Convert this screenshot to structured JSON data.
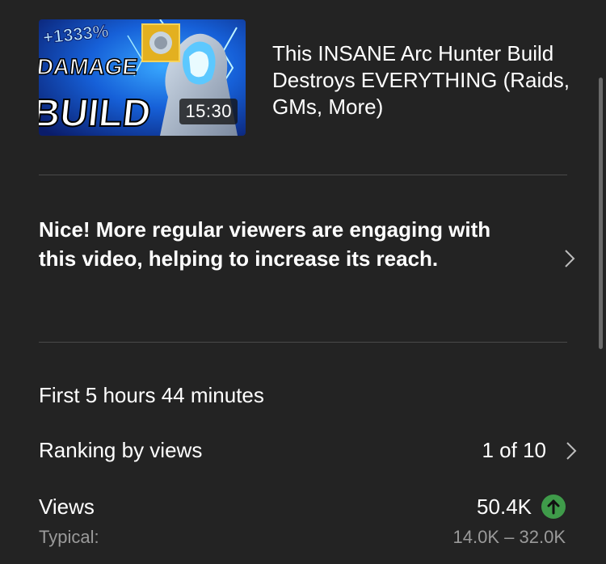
{
  "video": {
    "thumbnail_text": [
      "+1333%",
      "DAMAGE",
      "BUILD"
    ],
    "duration": "15:30",
    "title": "This INSANE Arc Hunter Build Destroys EVERYTHING (Raids, GMs, More)"
  },
  "insight": {
    "message": "Nice! More regular viewers are engaging with this video, helping to increase its reach."
  },
  "stats": {
    "period": "First 5 hours 44 minutes",
    "ranking_label": "Ranking by views",
    "ranking_value": "1 of 10",
    "views_label": "Views",
    "views_value": "50.4K",
    "views_trend": "up-arrow-icon",
    "typical_label": "Typical:",
    "typical_range": "14.0K – 32.0K"
  },
  "colors": {
    "background": "#232323",
    "trend_up": "#3f9b4a",
    "muted_text": "#9a9a9a"
  }
}
